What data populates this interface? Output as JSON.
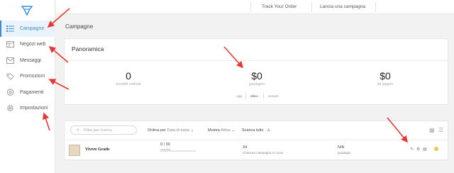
{
  "header": {
    "track_order": "Track Your Order",
    "launch_campaign": "Lancia una campagna"
  },
  "sidebar": {
    "items": [
      {
        "label": "Campagne",
        "icon": "list-icon",
        "active": true
      },
      {
        "label": "Negozi web",
        "icon": "store-icon",
        "active": false
      },
      {
        "label": "Messaggi",
        "icon": "mail-icon",
        "active": false
      },
      {
        "label": "Promozioni",
        "icon": "tag-icon",
        "active": false
      },
      {
        "label": "Pagamenti",
        "icon": "payment-icon",
        "active": false
      },
      {
        "label": "Impostazioni",
        "icon": "gear-icon",
        "active": false
      }
    ]
  },
  "page": {
    "title": "Campagne"
  },
  "overview": {
    "title": "Panoramica",
    "stats": [
      {
        "value": "0",
        "label": "prodotti ordinati"
      },
      {
        "value": "$0",
        "label": "guadagno"
      },
      {
        "value": "$0",
        "label": "da pagare"
      }
    ],
    "periods": [
      "oggi",
      "attivo",
      "sempre"
    ]
  },
  "list": {
    "search_placeholder": "Filtra per ricerca",
    "sort_label": "Ordina per",
    "sort_value": "Data di inizio",
    "show_label": "Mostra",
    "show_value": "Attive",
    "download_all": "Scarica tutto"
  },
  "campaigns": [
    {
      "name": "Vivere Gratis",
      "sold": "0 / 30",
      "sold_label": "venduti",
      "time": "2d",
      "time_label": "Chiusura campagna in corso",
      "profit": "N/A",
      "profit_label": "guadagni"
    }
  ],
  "colors": {
    "accent": "#3a8ed8",
    "arrow": "#e53935",
    "status_dot": "#f3c44d"
  }
}
